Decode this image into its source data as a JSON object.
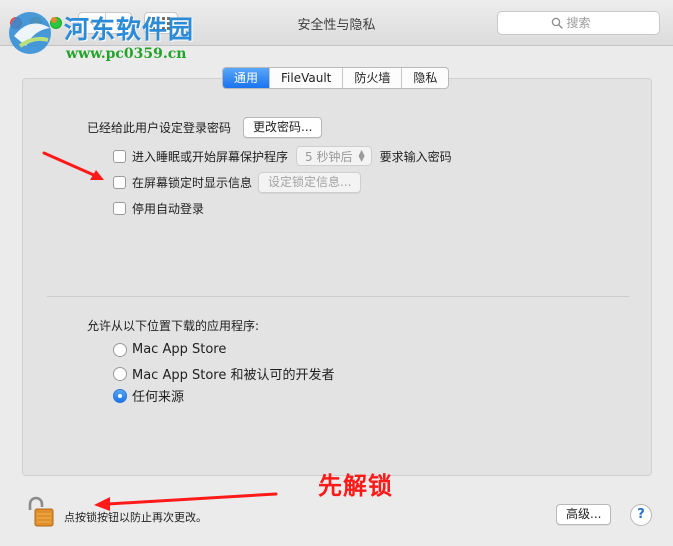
{
  "window": {
    "title": "安全性与隐私",
    "nav_back": "‹",
    "nav_forward": "›"
  },
  "search": {
    "placeholder": "搜索"
  },
  "watermark": {
    "name": "河东软件园",
    "url": "www.pc0359.cn"
  },
  "tabs": [
    {
      "label": "通用",
      "active": true
    },
    {
      "label": "FileVault",
      "active": false
    },
    {
      "label": "防火墙",
      "active": false
    },
    {
      "label": "隐私",
      "active": false
    }
  ],
  "general": {
    "password_set_label": "已经给此用户设定登录密码",
    "change_password_button": "更改密码...",
    "require_password": {
      "checked": false,
      "label_before": "进入睡眠或开始屏幕保护程序",
      "delay_value": "5 秒钟后",
      "label_after": "要求输入密码"
    },
    "show_message": {
      "checked": false,
      "label": "在屏幕锁定时显示信息",
      "button": "设定锁定信息..."
    },
    "disable_autologin": {
      "checked": false,
      "label": "停用自动登录"
    },
    "download_heading": "允许从以下位置下载的应用程序:",
    "download_options": [
      {
        "label": "Mac App Store",
        "selected": false
      },
      {
        "label": "Mac App Store 和被认可的开发者",
        "selected": false
      },
      {
        "label": "任何来源",
        "selected": true
      }
    ]
  },
  "footer": {
    "lock_text": "点按锁按钮以防止再次更改。",
    "advanced_button": "高级...",
    "help_button": "?"
  },
  "annotation": {
    "text": "先解锁",
    "color": "#ff1a1a"
  },
  "colors": {
    "accent": "#1a73ef",
    "panel": "#e3e3e3",
    "window": "#ebebeb"
  }
}
